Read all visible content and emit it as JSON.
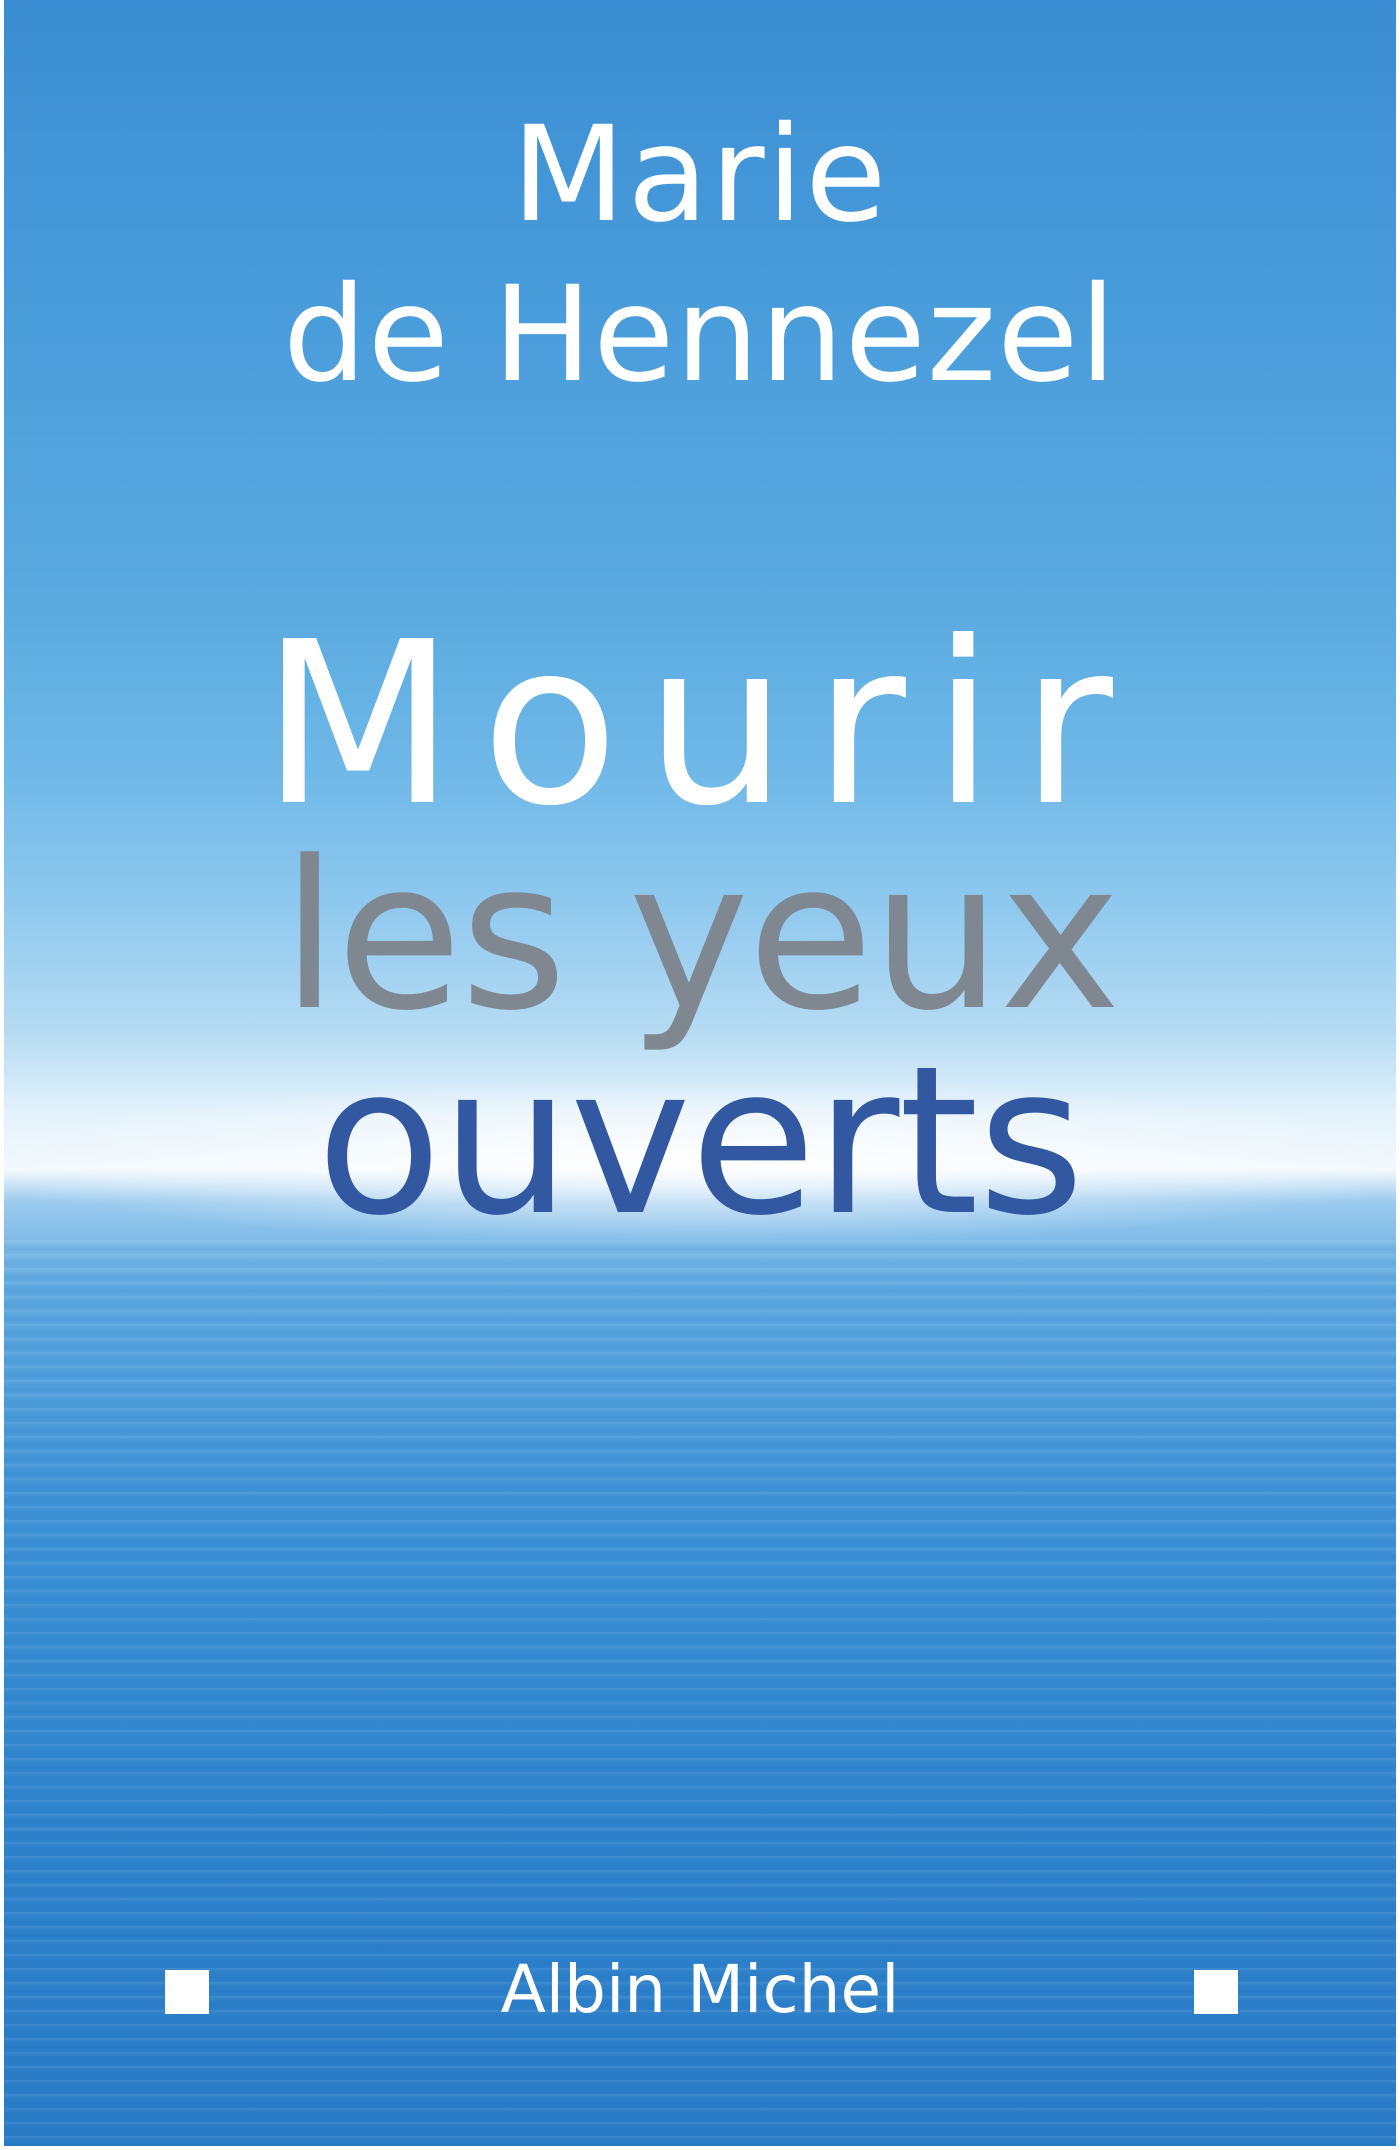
{
  "cover": {
    "author": {
      "first_line": "Marie",
      "second_line": "de Hennezel"
    },
    "title": {
      "line1": "Mourir",
      "line2": "les yeux",
      "line3": "ouverts"
    },
    "publisher": "Albin Michel",
    "colors": {
      "sky_top": "#3a8dd2",
      "horizon": "#f3f9fd",
      "sea": "#2a7cc6",
      "title_line1": "#ffffff",
      "title_line2": "#7f8790",
      "title_line3": "#3158a1"
    }
  }
}
